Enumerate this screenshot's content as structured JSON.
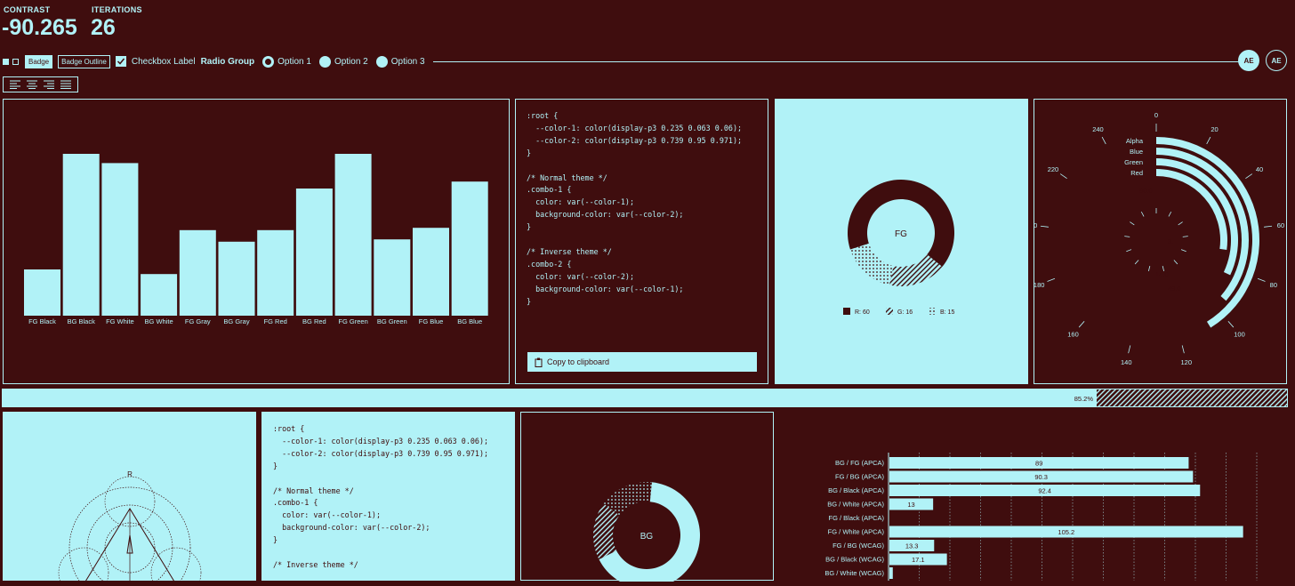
{
  "metrics": {
    "contrast_label": "CONTRAST",
    "contrast_value": "-90.265",
    "iterations_label": "ITERATIONS",
    "iterations_value": "26"
  },
  "toolbar": {
    "badge": "Badge",
    "badge_outline": "Badge Outline",
    "checkbox_label": "Checkbox Label",
    "radio_group_label": "Radio Group",
    "options": [
      "Option 1",
      "Option 2",
      "Option 3"
    ],
    "selected_option": "Option 1",
    "avatar_1": "AE",
    "avatar_2": "AE"
  },
  "align_icons": [
    "align-left-icon",
    "align-center-icon",
    "align-right-icon",
    "align-justify-icon"
  ],
  "bar_chart": {
    "categories": [
      "FG Black",
      "BG Black",
      "FG White",
      "BG White",
      "FG Gray",
      "BG Gray",
      "FG Red",
      "BG Red",
      "FG Green",
      "BG Green",
      "FG Blue",
      "BG Blue"
    ],
    "values": [
      20,
      70,
      66,
      18,
      37,
      32,
      37,
      55,
      70,
      33,
      38,
      58
    ]
  },
  "code_1": ":root {\n  --color-1: color(display-p3 0.235 0.063 0.06);\n  --color-2: color(display-p3 0.739 0.95 0.971);\n}\n\n/* Normal theme */\n.combo-1 {\n  color: var(--color-1);\n  background-color: var(--color-2);\n}\n\n/* Inverse theme */\n.combo-2 {\n  color: var(--color-2);\n  background-color: var(--color-1);\n}",
  "copy_button": "Copy to clipboard",
  "donut_fg": {
    "center": "FG",
    "legend": [
      "R: 60",
      "G: 16",
      "B: 15"
    ],
    "values": [
      60,
      16,
      15
    ]
  },
  "radial_chart": {
    "series": [
      "Alpha",
      "Blue",
      "Green",
      "Red"
    ],
    "values": [
      107,
      94.6,
      83.3,
      70.7
    ],
    "ticks": [
      "0",
      "20",
      "40",
      "60",
      "80",
      "100",
      "120",
      "140",
      "160",
      "180",
      "200",
      "220",
      "240"
    ],
    "visible_labels": [
      "90.0",
      "3.",
      "14.0",
      "49.0"
    ]
  },
  "progress": {
    "value": 0.852,
    "label": "85.2%"
  },
  "radar": {
    "label": "R"
  },
  "code_2": ":root {\n  --color-1: color(display-p3 0.235 0.063 0.06);\n  --color-2: color(display-p3 0.739 0.95 0.971);\n}\n\n/* Normal theme */\n.combo-1 {\n  color: var(--color-1);\n  background-color: var(--color-2);\n}\n\n/* Inverse theme */",
  "donut_bg": {
    "center": "BG",
    "values": [
      60,
      16,
      15
    ]
  },
  "hbar_chart": {
    "categories": [
      "BG / FG (APCA)",
      "FG / BG (APCA)",
      "BG / Black (APCA)",
      "BG / White (APCA)",
      "FG / Black (APCA)",
      "FG / White (APCA)",
      "FG / BG (WCAG)",
      "BG / Black (WCAG)",
      "BG / White (WCAG)"
    ],
    "values": [
      89,
      90.3,
      92.4,
      13,
      0,
      105.2,
      13.3,
      17.1,
      1
    ],
    "labels": [
      "89",
      "90.3",
      "92.4",
      "13",
      "",
      "105.2",
      "13.3",
      "17.1",
      ""
    ]
  },
  "colors": {
    "background": "#3f0d0e",
    "foreground": "#b1f2f7"
  }
}
